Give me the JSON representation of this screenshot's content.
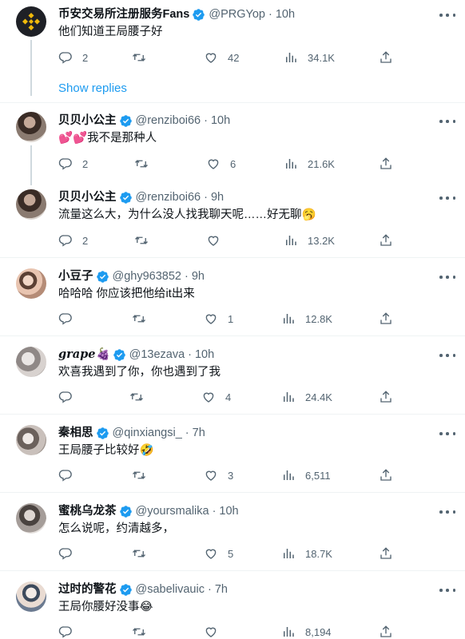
{
  "tweets": [
    {
      "name": "币安交易所注册服务Fans",
      "handle": "@PRGYop",
      "time": "10h",
      "text": "他们知道王局腰子好",
      "replies": "2",
      "retweets": "",
      "likes": "42",
      "views": "34.1K",
      "avatar": "binance"
    },
    {
      "name": "贝贝小公主",
      "handle": "@renziboi66",
      "time": "10h",
      "text": "💕💕我不是那种人",
      "replies": "2",
      "retweets": "",
      "likes": "6",
      "views": "21.6K",
      "avatar": "photo-a"
    },
    {
      "name": "贝贝小公主",
      "handle": "@renziboi66",
      "time": "9h",
      "text": "流量这么大，为什么没人找我聊天呢……好无聊🥱",
      "replies": "2",
      "retweets": "",
      "likes": "",
      "views": "13.2K",
      "avatar": "photo-a"
    },
    {
      "name": "小豆子",
      "handle": "@ghy963852",
      "time": "9h",
      "text": "哈哈哈  你应该把他给it出来",
      "replies": "",
      "retweets": "",
      "likes": "1",
      "views": "12.8K",
      "avatar": "photo-b"
    },
    {
      "name": "grape🍇",
      "handle": "@13ezava",
      "time": "10h",
      "text": "欢喜我遇到了你，你也遇到了我",
      "replies": "",
      "retweets": "",
      "likes": "4",
      "views": "24.4K",
      "avatar": "photo-c"
    },
    {
      "name": "秦相思",
      "handle": "@qinxiangsi_",
      "time": "7h",
      "text": "王局腰子比较好🤣",
      "replies": "",
      "retweets": "",
      "likes": "3",
      "views": "6,511",
      "avatar": "photo-d"
    },
    {
      "name": "蜜桃乌龙茶",
      "handle": "@yoursmalika",
      "time": "10h",
      "text": "怎么说呢，约清越多，",
      "replies": "",
      "retweets": "",
      "likes": "5",
      "views": "18.7K",
      "avatar": "photo-e"
    },
    {
      "name": "过时的警花",
      "handle": "@sabelivauic",
      "time": "7h",
      "text": "王局你腰好没事😂",
      "replies": "",
      "retweets": "",
      "likes": "",
      "views": "8,194",
      "avatar": "photo-f"
    }
  ],
  "show_replies_label": "Show replies",
  "colors": {
    "accent": "#1d9bf0",
    "muted": "#536471",
    "text": "#0f1419",
    "binance": "#f0b90b"
  }
}
